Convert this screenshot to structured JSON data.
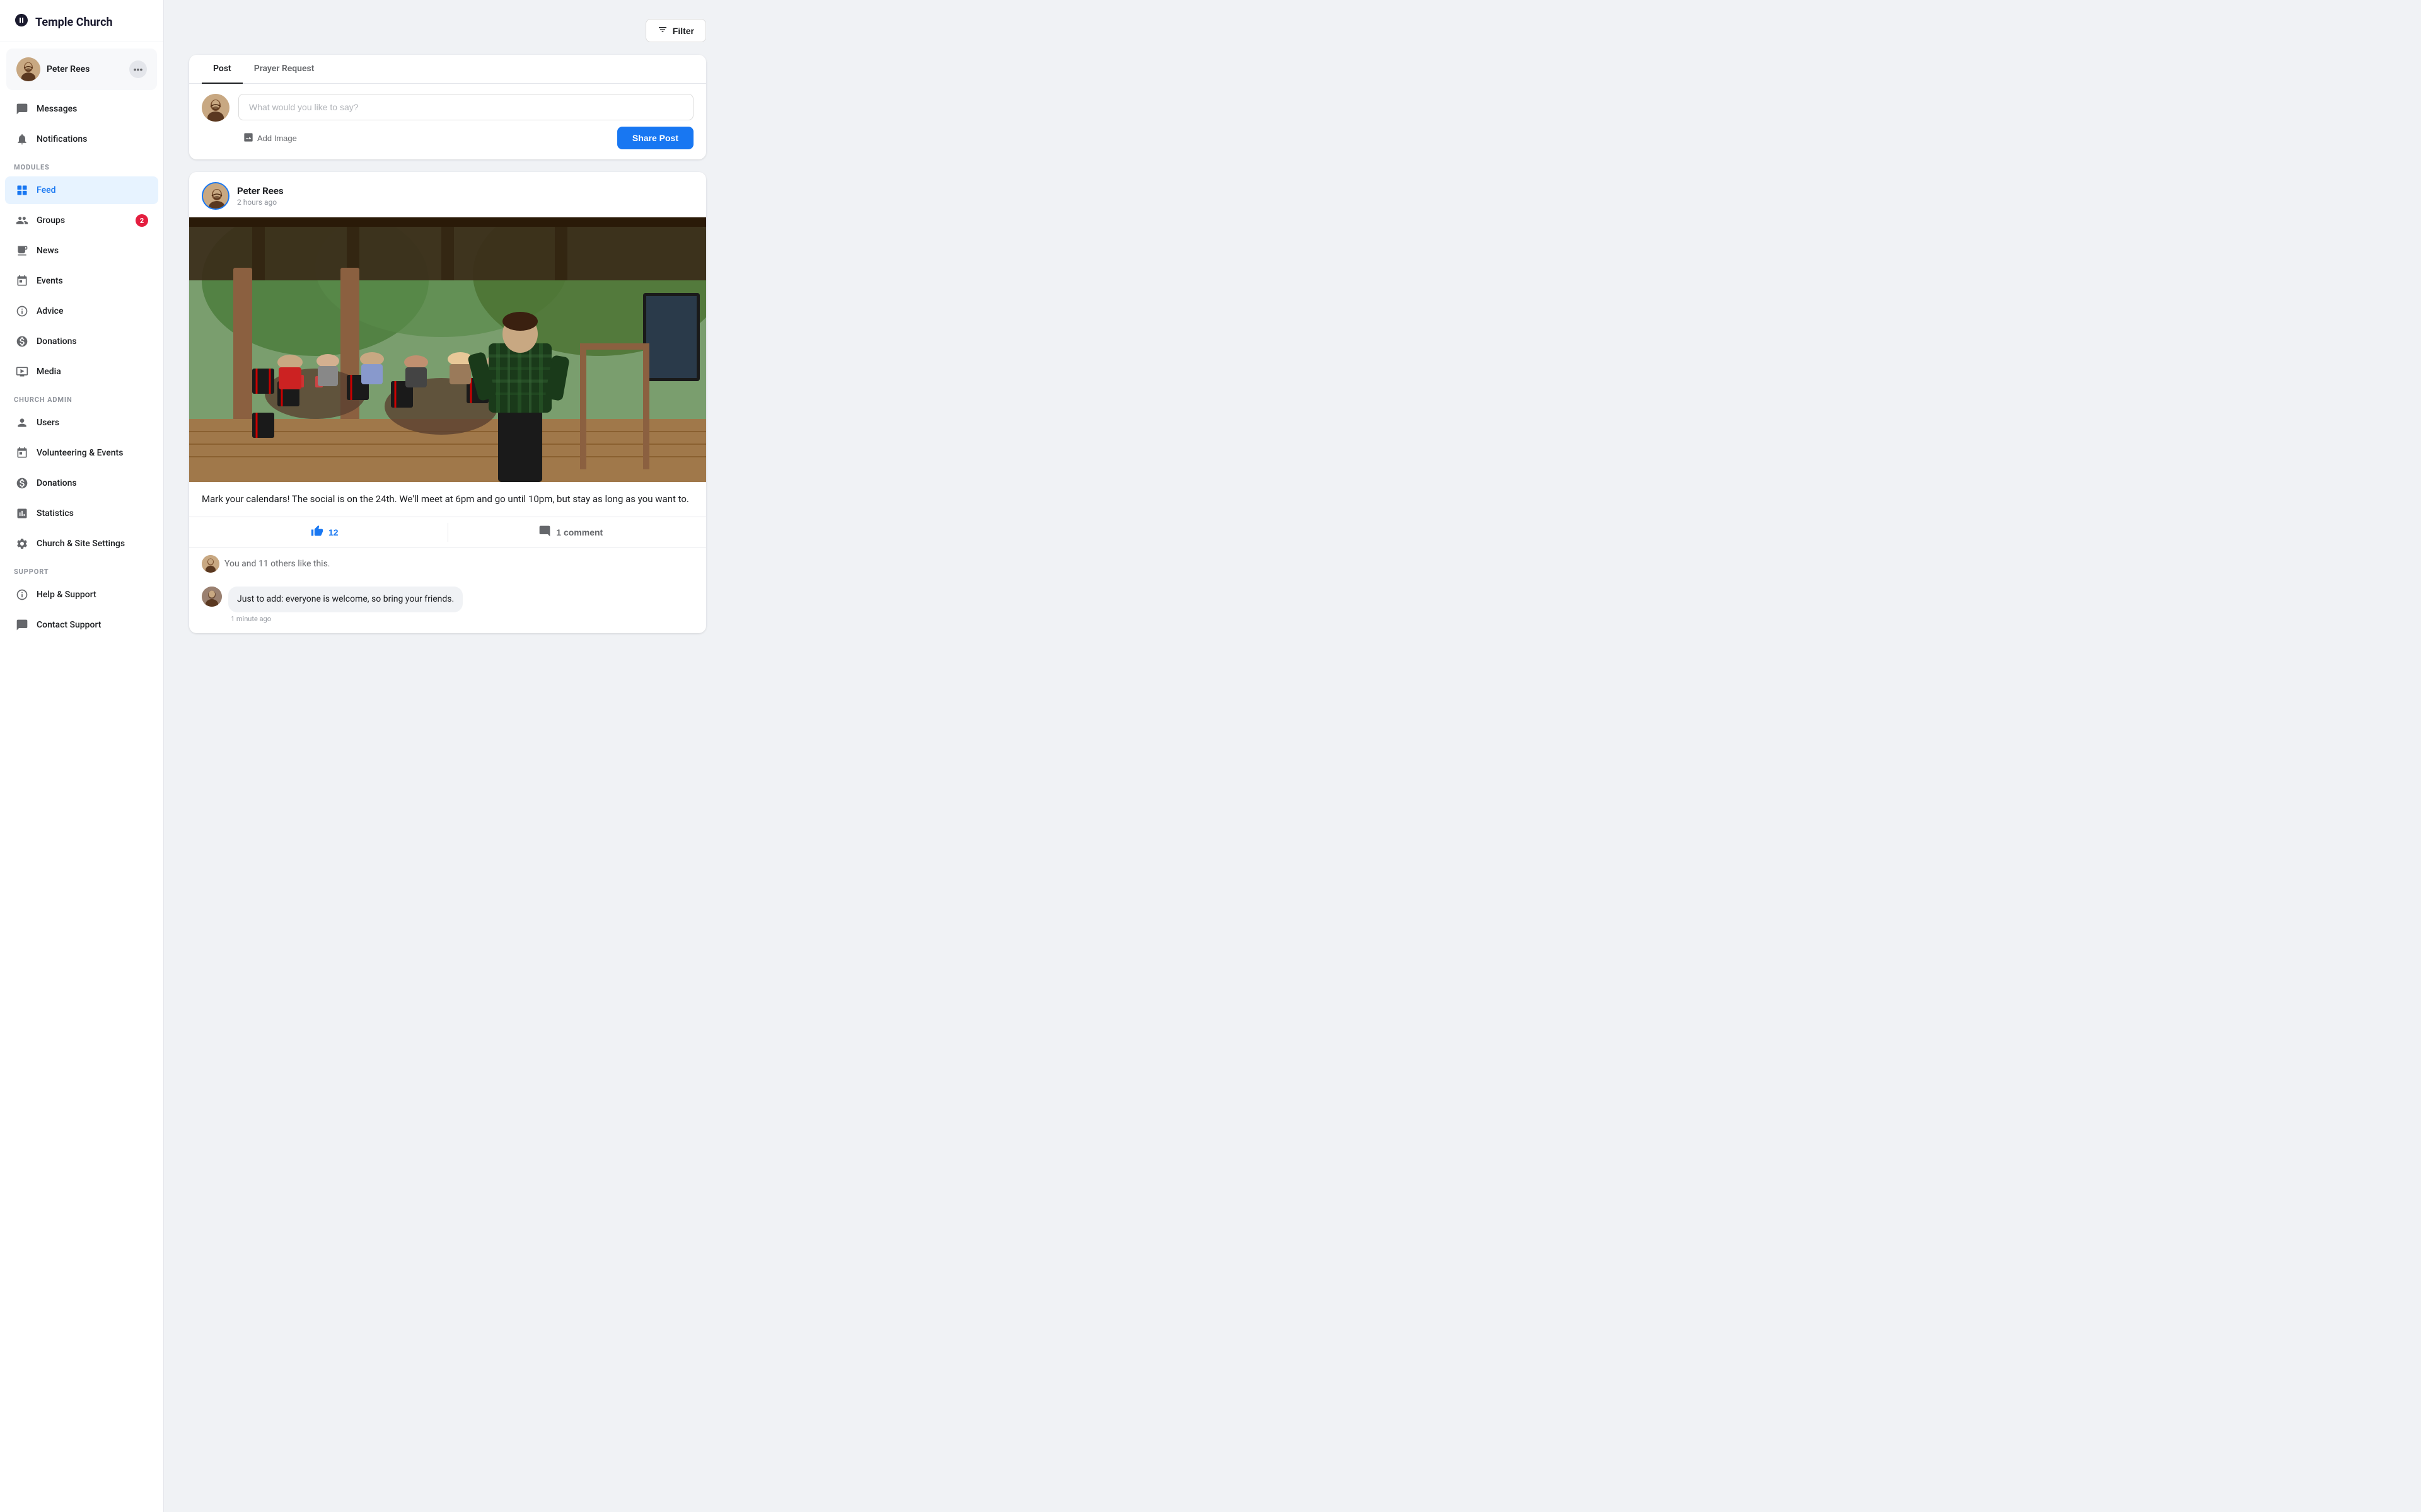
{
  "app": {
    "title": "Temple Church"
  },
  "user": {
    "name": "Peter Rees",
    "more_label": "···"
  },
  "sidebar": {
    "modules_label": "MODULES",
    "church_admin_label": "CHURCH ADMIN",
    "support_label": "SUPPORT",
    "nav_items_modules": [
      {
        "id": "feed",
        "label": "Feed",
        "icon": "feed-icon",
        "active": true
      },
      {
        "id": "groups",
        "label": "Groups",
        "icon": "groups-icon",
        "badge": "2"
      },
      {
        "id": "news",
        "label": "News",
        "icon": "news-icon"
      },
      {
        "id": "events",
        "label": "Events",
        "icon": "events-icon"
      },
      {
        "id": "advice",
        "label": "Advice",
        "icon": "advice-icon"
      },
      {
        "id": "donations",
        "label": "Donations",
        "icon": "donations-icon"
      },
      {
        "id": "media",
        "label": "Media",
        "icon": "media-icon"
      }
    ],
    "nav_items_admin": [
      {
        "id": "users",
        "label": "Users",
        "icon": "users-icon"
      },
      {
        "id": "volunteering",
        "label": "Volunteering & Events",
        "icon": "volunteering-icon"
      },
      {
        "id": "admin-donations",
        "label": "Donations",
        "icon": "admin-donations-icon"
      },
      {
        "id": "statistics",
        "label": "Statistics",
        "icon": "statistics-icon"
      },
      {
        "id": "settings",
        "label": "Church & Site Settings",
        "icon": "settings-icon"
      }
    ],
    "nav_items_support": [
      {
        "id": "help",
        "label": "Help & Support",
        "icon": "help-icon"
      },
      {
        "id": "contact",
        "label": "Contact Support",
        "icon": "contact-icon"
      }
    ],
    "messages_label": "Messages",
    "notifications_label": "Notifications"
  },
  "filter": {
    "label": "Filter"
  },
  "composer": {
    "tab_post": "Post",
    "tab_prayer": "Prayer Request",
    "placeholder": "What would you like to say?",
    "add_image_label": "Add Image",
    "share_label": "Share Post"
  },
  "post": {
    "author": "Peter Rees",
    "time_ago": "2 hours ago",
    "text": "Mark your calendars! The social is on the 24th. We'll meet at 6pm and go until 10pm, but stay as long as you want to.",
    "likes_count": "12",
    "comments_count": "1 comment",
    "likes_summary": "You and 11 others like this.",
    "comment": {
      "text": "Just to add: everyone is welcome, so bring your friends.",
      "time": "1 minute ago"
    }
  }
}
